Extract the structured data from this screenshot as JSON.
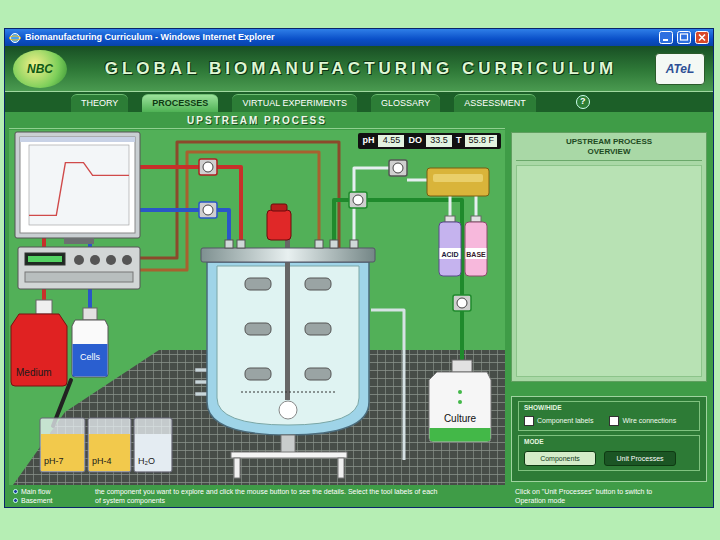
{
  "window": {
    "title": "Biomanufacturing Curriculum - Windows Internet Explorer"
  },
  "header": {
    "logo_left": "NBC",
    "title": "GLOBAL BIOMANUFACTURING CURRICULUM",
    "logo_right": "ATeL"
  },
  "tabs": [
    {
      "label": "THEORY",
      "selected": false
    },
    {
      "label": "PROCESSES",
      "selected": true
    },
    {
      "label": "VIRTUAL EXPERIMENTS",
      "selected": false
    },
    {
      "label": "GLOSSARY",
      "selected": false
    },
    {
      "label": "ASSESSMENT",
      "selected": false
    }
  ],
  "help": "?",
  "section_title": "UPSTREAM PROCESS",
  "readouts": [
    {
      "label": "pH",
      "value": "4.55"
    },
    {
      "label": "DO",
      "value": "33.5"
    },
    {
      "label": "T",
      "value": "55.8 F"
    }
  ],
  "diagram": {
    "medium": "Medium",
    "cells": "Cells",
    "acid": "ACID",
    "base": "BASE",
    "culture": "Culture",
    "beakers": [
      {
        "label": "pH-7",
        "color": "#f2c94c"
      },
      {
        "label": "pH-4",
        "color": "#f2c94c"
      },
      {
        "label": "H₂O",
        "color": "#e4ecf2"
      }
    ]
  },
  "monitor": {
    "series": [
      {
        "values": [
          0.12,
          0.12,
          0.12,
          0.12,
          0.78,
          0.78,
          0.78,
          0.62,
          0.62,
          0.62,
          0.62,
          0.62
        ]
      }
    ]
  },
  "overview": {
    "title_lines": [
      "UPSTREAM PROCESS",
      "OVERVIEW"
    ]
  },
  "show_hide": {
    "title": "SHOW/HIDE",
    "options": [
      {
        "label": "Component labels",
        "checked": false
      },
      {
        "label": "Wire connections",
        "checked": false
      }
    ]
  },
  "mode": {
    "title": "MODE",
    "buttons": [
      {
        "label": "Components",
        "selected": true
      },
      {
        "label": "Unit Processes",
        "selected": false
      }
    ]
  },
  "legend": [
    "Main flow",
    "Basement"
  ],
  "instructions": [
    "the component you want to explore and click the mouse button to see the details. Select the tool labels of each",
    "of system components"
  ],
  "hint": [
    "Click on \"Unit Processes\" button to switch to",
    "Operation mode"
  ]
}
